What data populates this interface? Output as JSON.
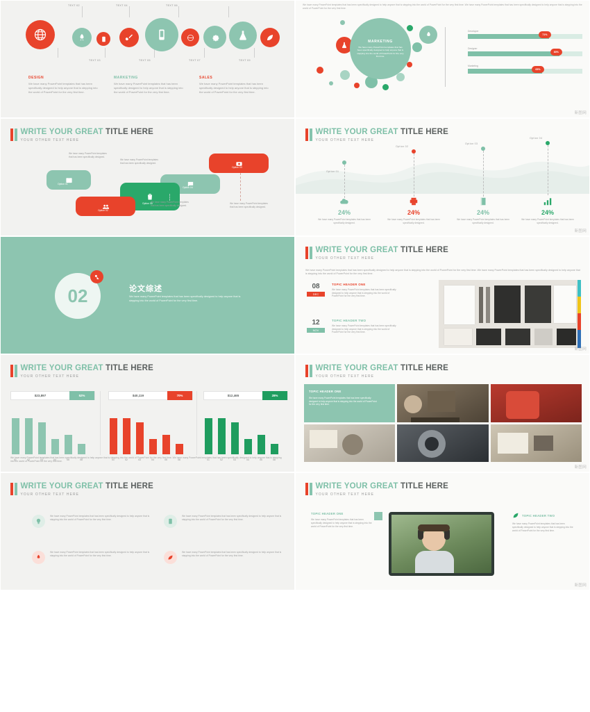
{
  "deck": {
    "watermark": "新图网",
    "slide1": {
      "top_labels": [
        "TEXT 02",
        "TEXT 04",
        "TEXT 06"
      ],
      "bottom_labels": [
        "TEXT 03",
        "TEXT 05",
        "TEXT 07",
        "TEXT 09"
      ],
      "icons": [
        "globe-icon",
        "rocket-icon",
        "tablet-icon",
        "brush-icon",
        "mobile-icon",
        "world-icon",
        "gear-icon",
        "flask-icon",
        "leaf-icon"
      ],
      "columns": [
        {
          "heading": "DESIGN",
          "body": "We have many PowerPoint templates that has been specifically designed to help anyone that is stepping into the world of PowerPoint for the very first time."
        },
        {
          "heading": "MARKETING",
          "body": "We have many PowerPoint templates that has been specifically designed to help anyone that is stepping into the world of PowerPoint for the very first time."
        },
        {
          "heading": "SALES",
          "body": "We have many PowerPoint templates that has been specifically designed to help anyone that is stepping into the world of PowerPoint for the very first time."
        }
      ]
    },
    "slide2": {
      "top_text": "We have many PowerPoint templates that has been specifically designed to help anyone that is stepping into the world of PowerPoint for the very first time. We have many PowerPoint templates that has been specifically designed to help anyone that is stepping into the world of PowerPoint for the very first time.",
      "center": {
        "title": "MARKETING",
        "body": "We have many PowerPoint templates that has been specifically designed to help anyone that is stepping into the world of PowerPoint for the very first time."
      },
      "bars": [
        {
          "label": "Developer",
          "value": "71%",
          "pct": 71
        },
        {
          "label": "Designer",
          "value": "80%",
          "pct": 80
        },
        {
          "label": "Marketing",
          "value": "65%",
          "pct": 65
        }
      ],
      "icons": [
        "flask-icon",
        "rocket-icon"
      ]
    },
    "slide3": {
      "title_a": "WRITE YOUR GREAT",
      "title_b": "TITLE HERE",
      "subtitle": "YOUR OTHER TEXT  HERE",
      "cards": [
        {
          "tag": "Option 01",
          "icon": "camera-icon"
        },
        {
          "tag": "Option 02",
          "icon": "users-icon"
        },
        {
          "tag": "Option 03",
          "icon": "trash-icon"
        },
        {
          "tag": "Option 04",
          "icon": "chat-icon"
        },
        {
          "tag": "Option 05",
          "icon": "calendar-icon"
        }
      ],
      "notes": [
        "We have many PowerPoint templates that has been specifically designed.",
        "We have many PowerPoint templates that has been specifically designed.",
        "We have many PowerPoint templates that has been specifically designed.",
        "We have many PowerPoint templates that has been specifically designed.",
        "We have many PowerPoint templates that has been specifically designed."
      ]
    },
    "slide4": {
      "title_a": "WRITE YOUR GREAT",
      "title_b": "TITLE HERE",
      "subtitle": "YOUR OTHER TEXT  HERE",
      "items": [
        {
          "option": "Option 01",
          "pct": "24%",
          "color": "#7fc0a8",
          "icon": "cloud-icon",
          "body": "We have many PowerPoint templates that has been specifically designed."
        },
        {
          "option": "Option 02",
          "pct": "24%",
          "color": "#e8432b",
          "icon": "printer-icon",
          "body": "We have many PowerPoint templates that has been specifically designed."
        },
        {
          "option": "Option 03",
          "pct": "24%",
          "color": "#7fc0a8",
          "icon": "book-icon",
          "body": "We have many PowerPoint templates that has been specifically designed."
        },
        {
          "option": "Option 04",
          "pct": "24%",
          "color": "#2aa86a",
          "icon": "chart-icon",
          "body": "We have many PowerPoint templates that has been specifically designed."
        }
      ]
    },
    "slide5": {
      "number": "02",
      "badge_icon": "key-icon",
      "title": "论文综述",
      "body": "We have many PowerPoint templates that has been specifically designed to help anyone that is stepping into the world of PowerPoint for the very first time."
    },
    "slide6": {
      "title_a": "WRITE YOUR GREAT",
      "title_b": "TITLE HERE",
      "subtitle": "YOUR OTHER TEXT  HERE",
      "intro": "We have many PowerPoint templates that has been specifically designed to help anyone that is stepping into the world of PowerPoint for the very first time. We have many PowerPoint templates that has been specifically designed to help anyone that is stepping into the world of PowerPoint for the very first time.",
      "entries": [
        {
          "day": "08",
          "month": "DEC",
          "month_color": "#e8432b",
          "heading": "TOPIC HEADER  ONE",
          "heading_color": "#e8432b",
          "body": "We have many PowerPoint templates that has been specifically designed to help anyone that is stepping into the world of PowerPoint for the very first time."
        },
        {
          "day": "12",
          "month": "NOV",
          "month_color": "#7fc0a8",
          "heading": "TOPIC HEADER  TWO",
          "heading_color": "#7fc0a8",
          "body": "We have many PowerPoint templates that has been specifically designed to help anyone that is stepping into the world of PowerPoint for the very first time."
        }
      ]
    },
    "slide7": {
      "title_a": "WRITE YOUR GREAT",
      "title_b": "TITLE HERE",
      "subtitle": "YOUR OTHER TEXT  HERE",
      "groups": [
        {
          "amount": "$23,897",
          "badge": "52%",
          "badge_color": "#7fc0a8",
          "bar_color": "#8dc5b0"
        },
        {
          "amount": "$40,119",
          "badge": "70%",
          "badge_color": "#e8432b",
          "bar_color": "#e8432b"
        },
        {
          "amount": "$12,465",
          "badge": "28%",
          "badge_color": "#1f9d5f",
          "bar_color": "#1f9d5f"
        }
      ],
      "categories": [
        "01",
        "02",
        "03",
        "04",
        "05",
        "06"
      ],
      "values": [
        32,
        32,
        28,
        12,
        15,
        7.6
      ],
      "footer": "We have many PowerPoint templates that has been specifically designed to help anyone that is stepping into the world of PowerPoint for the very first time. We have many PowerPoint templates that has been specifically designed to help anyone that is stepping into the world of PowerPoint for the very first time."
    },
    "slide8": {
      "title_a": "WRITE YOUR GREAT",
      "title_b": "TITLE HERE",
      "subtitle": "YOUR OTHER TEXT  HERE",
      "card": {
        "heading": "TOPIC HEADER  ONE",
        "body": "We have many PowerPoint templates that has been specifically designed to help anyone that is stepping into the world of PowerPoint for the very first time."
      }
    },
    "slide9": {
      "title_a": "WRITE YOUR GREAT",
      "title_b": "TITLE HERE",
      "subtitle": "YOUR OTHER TEXT  HERE",
      "items": [
        {
          "icon": "bulb-icon",
          "color": "#7fc0a8",
          "body": "We have many PowerPoint templates that has been specifically designed to help anyone that is stepping into the world of PowerPoint for the very first time."
        },
        {
          "icon": "tablet-icon",
          "color": "#7fc0a8",
          "body": "We have many PowerPoint templates that has been specifically designed to help anyone that is stepping into the world of PowerPoint for the very first time."
        },
        {
          "icon": "rocket-icon",
          "color": "#e8432b",
          "body": "We have many PowerPoint templates that has been specifically designed to help anyone that is stepping into the world of PowerPoint for the very first time."
        },
        {
          "icon": "leaf-icon",
          "color": "#e8432b",
          "body": "We have many PowerPoint templates that has been specifically designed to help anyone that is stepping into the world of PowerPoint for the very first time."
        }
      ]
    },
    "slide10": {
      "title_a": "WRITE YOUR GREAT",
      "title_b": "TITLE HERE",
      "subtitle": "YOUR OTHER TEXT  HERE",
      "left": {
        "heading": "TOPIC HEADER  ONE",
        "body": "We have many PowerPoint templates that has been specifically designed to help anyone that is stepping into the world of PowerPoint for the very first time."
      },
      "right": {
        "heading": "TOPIC HEADER  TWO",
        "icon": "leaf-icon",
        "body": "We have many PowerPoint templates that has been specifically designed to help anyone that is stepping into the world of PowerPoint for the very first time."
      }
    }
  }
}
